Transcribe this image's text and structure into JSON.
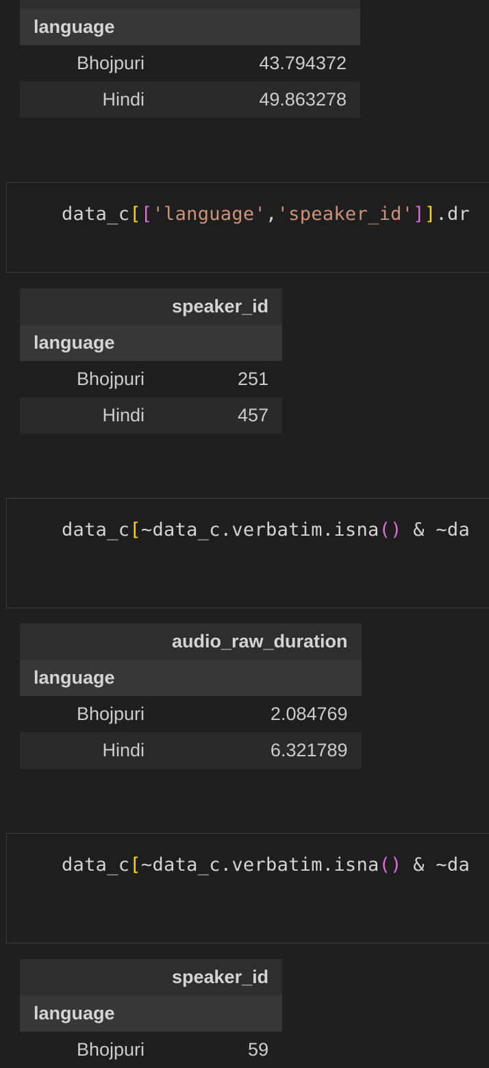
{
  "tables": [
    {
      "column": "",
      "index_name": "language",
      "rows": [
        {
          "label": "Bhojpuri",
          "value": "43.794372"
        },
        {
          "label": "Hindi",
          "value": "49.863278"
        }
      ]
    },
    {
      "column": "speaker_id",
      "index_name": "language",
      "rows": [
        {
          "label": "Bhojpuri",
          "value": "251"
        },
        {
          "label": "Hindi",
          "value": "457"
        }
      ]
    },
    {
      "column": "audio_raw_duration",
      "index_name": "language",
      "rows": [
        {
          "label": "Bhojpuri",
          "value": "2.084769"
        },
        {
          "label": "Hindi",
          "value": "6.321789"
        }
      ]
    },
    {
      "column": "speaker_id",
      "index_name": "language",
      "rows": [
        {
          "label": "Bhojpuri",
          "value": "59"
        }
      ]
    }
  ],
  "cells": [
    {
      "p1": "data_c",
      "b1": "[",
      "b2": "[",
      "s1": "'language'",
      "comma": ",",
      "s2": "'speaker_id'",
      "b3": "]",
      "b4": "]",
      "tail": ".dr"
    },
    {
      "p1": "data_c",
      "b1": "[",
      "mid": "~data_c.verbatim.isna",
      "paren": "()",
      "tail": " & ~da"
    },
    {
      "p1": "data_c",
      "b1": "[",
      "mid": "~data_c.verbatim.isna",
      "paren": "()",
      "tail": " & ~da"
    }
  ],
  "colors": {
    "background": "#1f1f1f",
    "bracket_level1": "#ffd700",
    "bracket_level2": "#da70d6",
    "string": "#ce9178"
  }
}
